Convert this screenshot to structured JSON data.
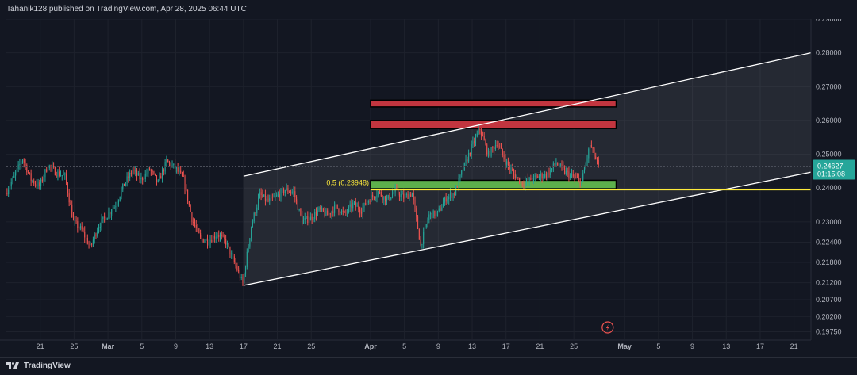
{
  "header": {
    "attribution": "Tahanik128 published on TradingView.com, Apr 28, 2025 06:44 UTC"
  },
  "footer": {
    "brand": "TradingView"
  },
  "colors": {
    "background": "#131722",
    "grid": "#1e222d",
    "up": "#26a69a",
    "down": "#ef5350",
    "fib": "#ffeb3b",
    "zone_red": "#c2353f",
    "zone_green": "#5db04c",
    "channel": "#ffffff",
    "price_tag": "#26a69a"
  },
  "chart_data": {
    "type": "candlestick",
    "price_scale": {
      "ylim": [
        0.1955,
        0.29
      ],
      "tick_labels": [
        {
          "label": "0.29000",
          "value": 0.29
        },
        {
          "label": "0.28000",
          "value": 0.28
        },
        {
          "label": "0.27000",
          "value": 0.27
        },
        {
          "label": "0.26000",
          "value": 0.26
        },
        {
          "label": "0.25000",
          "value": 0.25
        },
        {
          "label": "0.24000",
          "value": 0.24
        },
        {
          "label": "0.23000",
          "value": 0.23
        },
        {
          "label": "0.22400",
          "value": 0.224
        },
        {
          "label": "0.21800",
          "value": 0.218
        },
        {
          "label": "0.21200",
          "value": 0.212
        },
        {
          "label": "0.20700",
          "value": 0.207
        },
        {
          "label": "0.20200",
          "value": 0.202
        },
        {
          "label": "0.19750",
          "value": 0.1975
        }
      ]
    },
    "time_scale": {
      "start": "2025-02-17",
      "end": "2025-05-23",
      "ticks": [
        {
          "label": "21",
          "date": "2025-02-21"
        },
        {
          "label": "25",
          "date": "2025-02-25"
        },
        {
          "label": "Mar",
          "date": "2025-03-01",
          "bold": true
        },
        {
          "label": "5",
          "date": "2025-03-05"
        },
        {
          "label": "9",
          "date": "2025-03-09"
        },
        {
          "label": "13",
          "date": "2025-03-13"
        },
        {
          "label": "17",
          "date": "2025-03-17"
        },
        {
          "label": "21",
          "date": "2025-03-21"
        },
        {
          "label": "25",
          "date": "2025-03-25"
        },
        {
          "label": "Apr",
          "date": "2025-04-01",
          "bold": true
        },
        {
          "label": "5",
          "date": "2025-04-05"
        },
        {
          "label": "9",
          "date": "2025-04-09"
        },
        {
          "label": "13",
          "date": "2025-04-13"
        },
        {
          "label": "17",
          "date": "2025-04-17"
        },
        {
          "label": "21",
          "date": "2025-04-21"
        },
        {
          "label": "25",
          "date": "2025-04-25"
        },
        {
          "label": "May",
          "date": "2025-05-01",
          "bold": true
        },
        {
          "label": "5",
          "date": "2025-05-05"
        },
        {
          "label": "9",
          "date": "2025-05-09"
        },
        {
          "label": "13",
          "date": "2025-05-13"
        },
        {
          "label": "17",
          "date": "2025-05-17"
        },
        {
          "label": "21",
          "date": "2025-05-21"
        }
      ]
    },
    "price_path": [
      [
        "2025-02-17",
        0.2385
      ],
      [
        "2025-02-18",
        0.2432
      ],
      [
        "2025-02-19",
        0.2488
      ],
      [
        "2025-02-20",
        0.2425
      ],
      [
        "2025-02-21",
        0.2405
      ],
      [
        "2025-02-22",
        0.2468
      ],
      [
        "2025-02-23",
        0.2445
      ],
      [
        "2025-02-24",
        0.2435
      ],
      [
        "2025-02-25",
        0.23
      ],
      [
        "2025-02-26",
        0.2275
      ],
      [
        "2025-02-27",
        0.2225
      ],
      [
        "2025-02-28",
        0.229
      ],
      [
        "2025-03-01",
        0.232
      ],
      [
        "2025-03-02",
        0.2352
      ],
      [
        "2025-03-03",
        0.2412
      ],
      [
        "2025-03-04",
        0.2452
      ],
      [
        "2025-03-05",
        0.2425
      ],
      [
        "2025-03-06",
        0.2455
      ],
      [
        "2025-03-07",
        0.2415
      ],
      [
        "2025-03-08",
        0.2478
      ],
      [
        "2025-03-09",
        0.246
      ],
      [
        "2025-03-10",
        0.2425
      ],
      [
        "2025-03-11",
        0.231
      ],
      [
        "2025-03-12",
        0.225
      ],
      [
        "2025-03-13",
        0.2245
      ],
      [
        "2025-03-14",
        0.2265
      ],
      [
        "2025-03-15",
        0.224
      ],
      [
        "2025-03-16",
        0.218
      ],
      [
        "2025-03-17",
        0.2118
      ],
      [
        "2025-03-18",
        0.2288
      ],
      [
        "2025-03-19",
        0.238
      ],
      [
        "2025-03-20",
        0.236
      ],
      [
        "2025-03-21",
        0.2375
      ],
      [
        "2025-03-22",
        0.2395
      ],
      [
        "2025-03-23",
        0.2388
      ],
      [
        "2025-03-24",
        0.2302
      ],
      [
        "2025-03-25",
        0.231
      ],
      [
        "2025-03-26",
        0.2335
      ],
      [
        "2025-03-27",
        0.232
      ],
      [
        "2025-03-28",
        0.2345
      ],
      [
        "2025-03-29",
        0.2322
      ],
      [
        "2025-03-30",
        0.2352
      ],
      [
        "2025-03-31",
        0.2335
      ],
      [
        "2025-04-01",
        0.237
      ],
      [
        "2025-04-02",
        0.2388
      ],
      [
        "2025-04-03",
        0.2365
      ],
      [
        "2025-04-04",
        0.2392
      ],
      [
        "2025-04-05",
        0.2372
      ],
      [
        "2025-04-06",
        0.2385
      ],
      [
        "2025-04-07",
        0.223
      ],
      [
        "2025-04-08",
        0.232
      ],
      [
        "2025-04-09",
        0.2325
      ],
      [
        "2025-04-10",
        0.237
      ],
      [
        "2025-04-11",
        0.2385
      ],
      [
        "2025-04-12",
        0.2455
      ],
      [
        "2025-04-13",
        0.252
      ],
      [
        "2025-04-14",
        0.2575
      ],
      [
        "2025-04-15",
        0.2498
      ],
      [
        "2025-04-16",
        0.2535
      ],
      [
        "2025-04-17",
        0.248
      ],
      [
        "2025-04-18",
        0.244
      ],
      [
        "2025-04-19",
        0.2415
      ],
      [
        "2025-04-20",
        0.2425
      ],
      [
        "2025-04-21",
        0.2435
      ],
      [
        "2025-04-22",
        0.244
      ],
      [
        "2025-04-23",
        0.2475
      ],
      [
        "2025-04-24",
        0.2448
      ],
      [
        "2025-04-25",
        0.2432
      ],
      [
        "2025-04-26",
        0.2418
      ],
      [
        "2025-04-27",
        0.2528
      ],
      [
        "2025-04-28",
        0.2463
      ]
    ],
    "last_price": {
      "label": "0.24627",
      "countdown": "01:15:08"
    },
    "drawings": {
      "channel_upper": [
        [
          "2025-03-17",
          0.2435
        ],
        [
          "2025-05-23",
          0.28
        ]
      ],
      "channel_lower": [
        [
          "2025-03-17",
          0.2112
        ],
        [
          "2025-05-23",
          0.2447
        ]
      ],
      "red_zones": [
        {
          "start": "2025-04-01",
          "end": "2025-04-30",
          "top": 0.266,
          "bottom": 0.264
        },
        {
          "start": "2025-04-01",
          "end": "2025-04-30",
          "top": 0.26,
          "bottom": 0.2576
        }
      ],
      "green_zone": {
        "start": "2025-04-01",
        "end": "2025-04-30",
        "top": 0.2423,
        "bottom": 0.2398
      },
      "fib_line": {
        "label": "0.5 (0.23948)",
        "value": 0.23948,
        "start": "2025-04-01"
      }
    }
  }
}
